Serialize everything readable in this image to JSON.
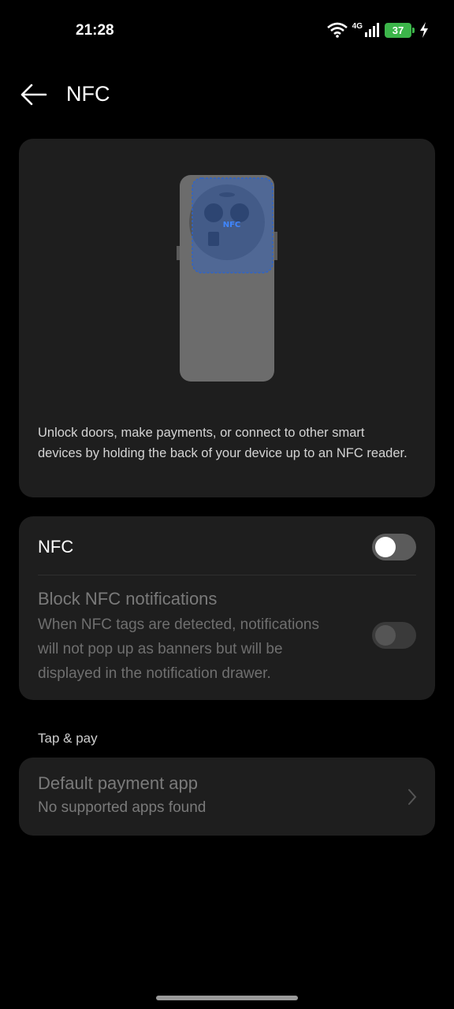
{
  "status_bar": {
    "time": "21:28",
    "network_label": "4G",
    "battery_level": "37",
    "icons": [
      "wifi-icon",
      "cell-signal-icon",
      "battery-icon",
      "charging-icon"
    ]
  },
  "app_bar": {
    "title": "NFC",
    "back_icon": "arrow-left-icon"
  },
  "hero": {
    "illustration": "phone-back-nfc-illustration",
    "description": "Unlock doors, make payments, or connect to other smart devices by holding the back of your device up to an NFC reader."
  },
  "settings": {
    "nfc": {
      "label": "NFC",
      "enabled": false
    },
    "block_notifications": {
      "label": "Block NFC notifications",
      "description_lines": [
        "When NFC tags are detected, notifications",
        "will not pop up as banners but will be",
        "displayed in the notification drawer."
      ],
      "enabled": false,
      "disabled": true
    }
  },
  "tap_pay": {
    "section_label": "Tap & pay",
    "default_app": {
      "label": "Default payment app",
      "value": "No supported apps found",
      "chevron_icon": "chevron-right-icon"
    }
  },
  "colors": {
    "background": "#000000",
    "card": "#1e1e1e",
    "battery": "#3cb54a",
    "nfc_highlight": "#2e64c8"
  }
}
